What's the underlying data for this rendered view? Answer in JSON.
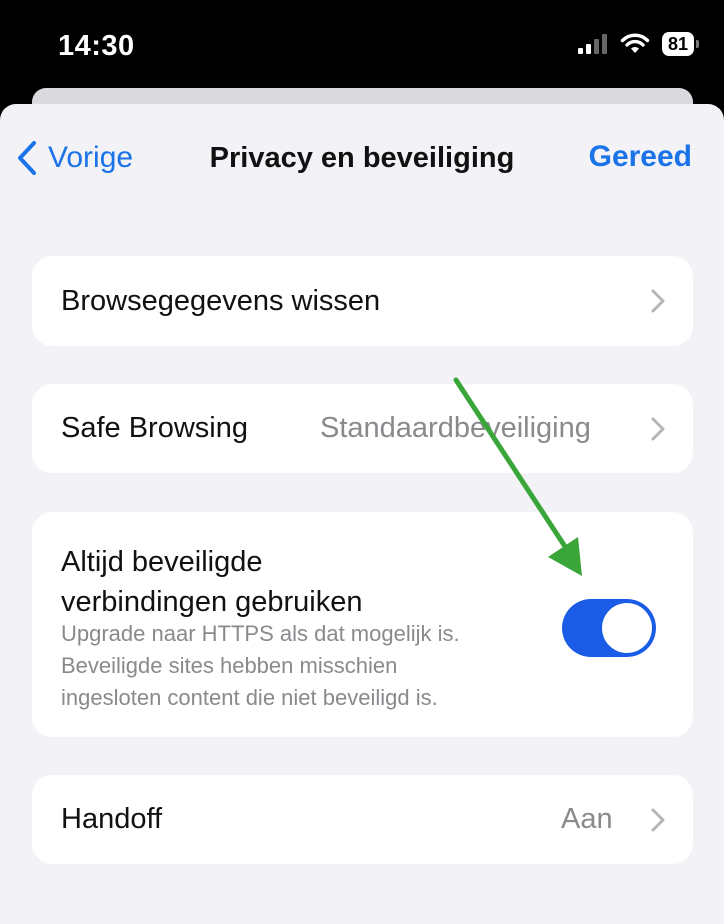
{
  "status_bar": {
    "time": "14:30",
    "battery": "81"
  },
  "nav": {
    "back_label": "Vorige",
    "title": "Privacy en beveiliging",
    "done_label": "Gereed"
  },
  "rows": {
    "clear_data": {
      "label": "Browsegegevens wissen"
    },
    "safe_browsing": {
      "label": "Safe Browsing",
      "value": "Standaardbeveiliging"
    },
    "secure_connections": {
      "label_line1": "Altijd beveiligde",
      "label_line2": "verbindingen gebruiken",
      "desc_line1": "Upgrade naar HTTPS als dat mogelijk is.",
      "desc_line2": "Beveiligde sites hebben misschien",
      "desc_line3": "ingesloten content die niet beveiligd is.",
      "toggle_on": true
    },
    "handoff": {
      "label": "Handoff",
      "value": "Aan"
    }
  },
  "colors": {
    "accent": "#1a73e8",
    "toggle": "#1a5ce5",
    "arrow": "#3aa63a",
    "background": "#f2f2f7"
  }
}
